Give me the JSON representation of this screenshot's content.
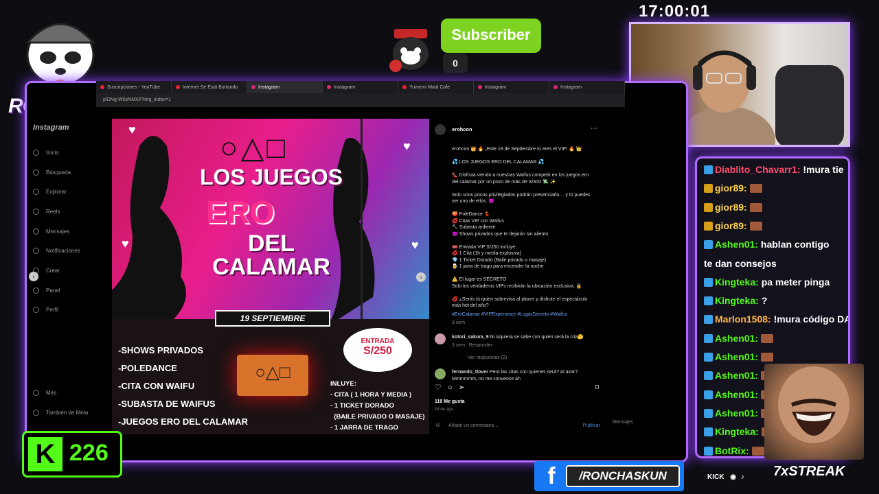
{
  "clock": "17:00:01",
  "subscriber": {
    "label": "Subscriber",
    "count": "0"
  },
  "logo_text": "RONCHAS",
  "browser": {
    "tabs": [
      "Suscripciones - YouTube",
      "Internet Se Está Burlando",
      "Instagram",
      "Instagram",
      "Yumemi Maid Cafe",
      "Instagram",
      "Instagram"
    ],
    "url": "p/DNg-W0sNMXl/?img_index=1"
  },
  "instagram": {
    "logo": "Instagram",
    "nav": [
      "Inicio",
      "Búsqueda",
      "Explorar",
      "Reels",
      "Mensajes",
      "Notificaciones",
      "Crear",
      "Panel",
      "Perfil"
    ],
    "more": "Más",
    "meta": "También de Meta"
  },
  "post_image": {
    "symbols": "○△□",
    "title1": "LOS JUEGOS",
    "title2": "ERO",
    "title3": "DEL",
    "title4": "CALAMAR",
    "date": "19 SEPTIEMBRE",
    "list": [
      "-SHOWS PRIVADOS",
      "-POLEDANCE",
      "-CITA CON WAIFU",
      "-SUBASTA DE WAIFUS",
      "-JUEGOS ERO DEL CALAMAR"
    ],
    "badge_top": "ENTRADA",
    "badge_price": "S/250",
    "includes": [
      "INLUYE:",
      "- CITA ( 1 HORA Y MEDIA )",
      "- 1 TICKET DORADO",
      "  (BAILE PRIVADO O MASAJE)",
      "- 1 JARRA DE TRAGO"
    ]
  },
  "post_panel": {
    "username": "erohcon",
    "caption": "erohcon 👑 🔥 ¡Este 19 de Septiembre tú eres el VIP! 🔥 👑\n\n💦 LOS JUEGOS ERO DEL CALAMAR 💦\n\n👠 Disfruta viendo a nuestras Waifus competir en los juegos ero del calamar por un pozo de más de S/300 💸 ✨\n\nSolo unos pocos privilegiados podrán presenciarlo… y tú puedes ser uno de ellos. 😈\n\n🍑 PoleDance 💃\n💋 Citas VIP con Waifus\n🔨 Subasta ardiente\n😈 Shows privados que te dejarán sin aliento\n\n🎟️ Entrada VIP S/250 incluye:\n💋 1 Cita (1h y media explosiva)\n💎 1 Ticket Dorado (Baile privado o masaje)\n🍺 1 jarra de trago para encender la noche\n\n⚠️ El lugar es SECRETO\nSolo los verdaderos VIPs recibirán la ubicación exclusiva. 🔒\n\n💋 ¿Serás tú quien sobreviva al placer y disfrute el espectáculo más hot del año?",
    "hashtags": "#EroCalamar #VIPExperience #LugarSecreto #Waifus",
    "caption_time": "3 sem",
    "comment1_user": "kotori_sakura_9",
    "comment1_text": "Ni siquiera se sabe con quien será la cita🤔",
    "comment1_meta": "3 sem   Responder",
    "view_replies": "Ver respuestas (2)",
    "comment2_user": "fernando_tlover",
    "comment2_text": "Pero las citas con quienes será? Al azar? Mmmmmm, no me convence ah",
    "likes": "119 Me gusta",
    "date": "18 de ago.",
    "add_comment": "Añade un comentario...",
    "publish": "Publicar",
    "messages": "Mensajes"
  },
  "chat": [
    {
      "user": "Diablito_Chavarr1",
      "text": "!mura tie",
      "color": "#ff4d6d"
    },
    {
      "user": "gior89",
      "text": "",
      "color": "#ffd54a"
    },
    {
      "user": "gior89",
      "text": "",
      "color": "#ffd54a"
    },
    {
      "user": "gior89",
      "text": "",
      "color": "#ffd54a"
    },
    {
      "user": "Ashen01",
      "text": "hablan contigo",
      "color": "#53fc18"
    },
    {
      "user": "",
      "text": "te dan consejos",
      "color": "#fff"
    },
    {
      "user": "Kingteka",
      "text": "pa meter pinga",
      "color": "#53fc18"
    },
    {
      "user": "Kingteka",
      "text": "?",
      "color": "#53fc18"
    },
    {
      "user": "Marlon1508",
      "text": "!mura código DA",
      "color": "#ffb84d"
    },
    {
      "user": "Ashen01",
      "text": "",
      "color": "#53fc18"
    },
    {
      "user": "Ashen01",
      "text": "",
      "color": "#53fc18"
    },
    {
      "user": "Ashen01",
      "text": "",
      "color": "#53fc18"
    },
    {
      "user": "Ashen01",
      "text": "",
      "color": "#53fc18"
    },
    {
      "user": "Ashen01",
      "text": "",
      "color": "#53fc18"
    },
    {
      "user": "Kingteka",
      "text": "",
      "color": "#53fc18"
    },
    {
      "user": "BotRix",
      "text": "",
      "color": "#53fc18"
    }
  ],
  "kick_count": "226",
  "facebook_handle": "/RONCHASKUN",
  "streak": "7xSTREAK",
  "social_bar": "KICK",
  "colors": {
    "accent": "#b26bff",
    "kick": "#53fc18",
    "facebook": "#1877f2",
    "subscriber": "#7ed321"
  }
}
